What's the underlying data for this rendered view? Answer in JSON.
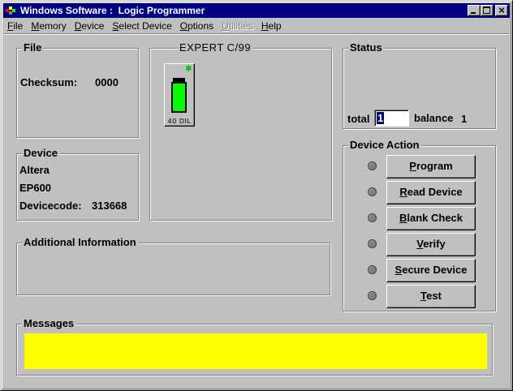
{
  "window": {
    "title": "Windows Software :  Logic Programmer",
    "controls": {
      "minimize": "_",
      "maximize": "□",
      "close": "×"
    }
  },
  "menu": [
    {
      "label": "File",
      "accel": "F",
      "rest": "ile",
      "disabled": false
    },
    {
      "label": "Memory",
      "accel": "M",
      "rest": "emory",
      "disabled": false
    },
    {
      "label": "Device",
      "accel": "D",
      "rest": "evice",
      "disabled": false
    },
    {
      "label": "Select Device",
      "accel": "S",
      "rest": "elect Device",
      "disabled": false
    },
    {
      "label": "Options",
      "accel": "O",
      "rest": "ptions",
      "disabled": false
    },
    {
      "label": "Utilities",
      "accel": "U",
      "rest": "tilities",
      "disabled": true
    },
    {
      "label": "Help",
      "accel": "H",
      "rest": "elp",
      "disabled": false
    }
  ],
  "file_group": {
    "label": "File",
    "checksum_label": "Checksum:",
    "checksum_value": "0000"
  },
  "programmer_group": {
    "label": "EXPERT  C/99",
    "socket_caption": "40 DIL",
    "indicator_color": "#00ff00"
  },
  "status_group": {
    "label": "Status",
    "total_label": "total",
    "total_value": "1",
    "balance_label": "balance",
    "balance_value": "1"
  },
  "device_group": {
    "label": "Device",
    "manufacturer": "Altera",
    "part": "EP600",
    "devicecode_label": "Devicecode:",
    "devicecode_value": "313668"
  },
  "device_action": {
    "label": "Device Action",
    "buttons": [
      {
        "accel": "P",
        "rest": "rogram",
        "pre": ""
      },
      {
        "accel": "R",
        "rest": "ead Device",
        "pre": ""
      },
      {
        "accel": "B",
        "rest": "lank Check",
        "pre": ""
      },
      {
        "accel": "V",
        "rest": "erify",
        "pre": ""
      },
      {
        "accel": "S",
        "rest": "ecure Device",
        "pre": ""
      },
      {
        "accel": "T",
        "rest": "est",
        "pre": ""
      }
    ]
  },
  "additional_info": {
    "label": "Additional Information"
  },
  "messages": {
    "label": "Messages",
    "background": "#ffff00"
  },
  "colors": {
    "titlebar": "#000080",
    "face": "#c0c0c0",
    "chip": "#00ff00"
  }
}
